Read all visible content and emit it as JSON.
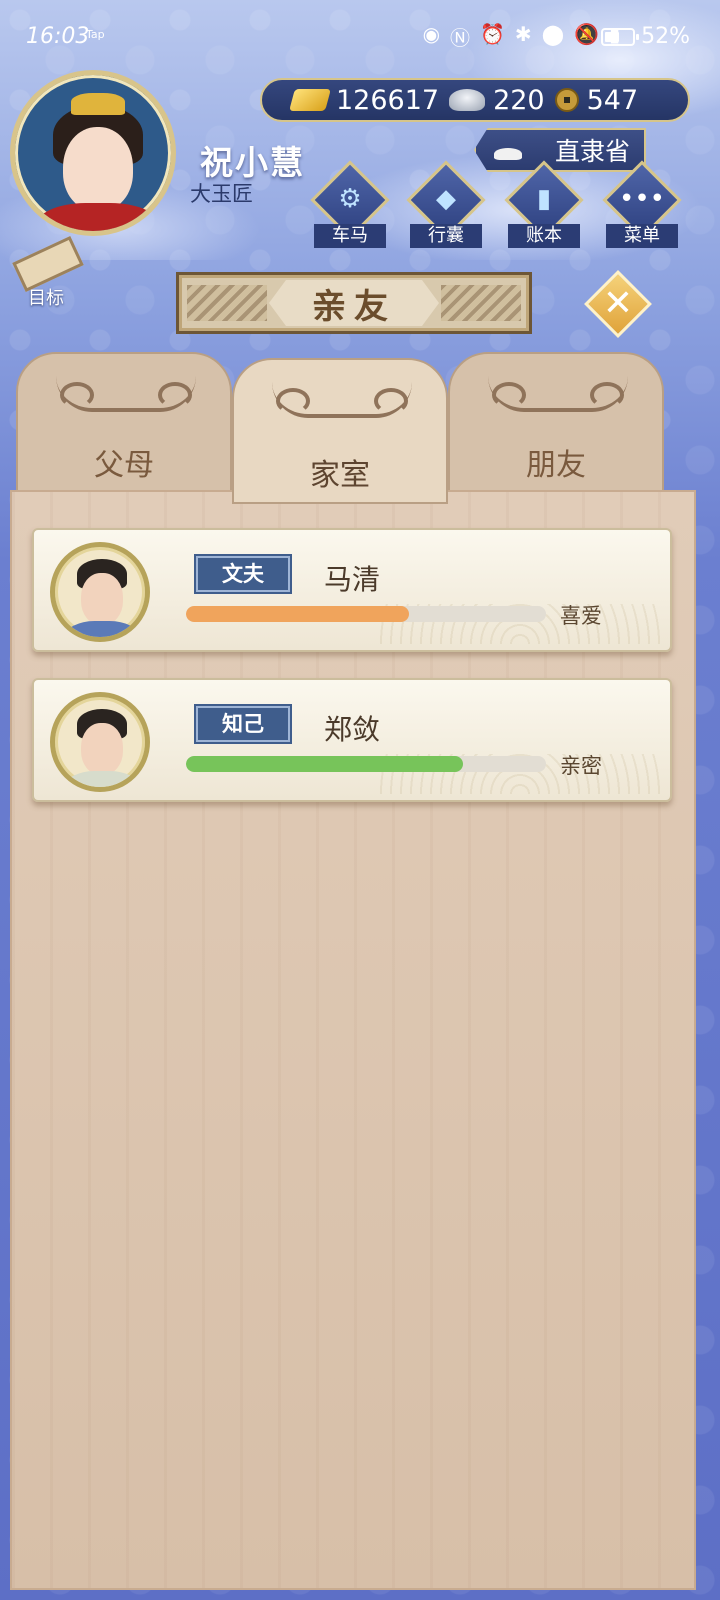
{
  "status_bar": {
    "time": "16:03",
    "tap_label": "Tap",
    "battery": "52%"
  },
  "player": {
    "name": "祝小慧",
    "title": "大玉匠"
  },
  "currency": {
    "gold": "126617",
    "silver": "220",
    "coins": "547"
  },
  "location": "直隶省",
  "menu": [
    {
      "label": "车马",
      "icon": "carriage-icon"
    },
    {
      "label": "行囊",
      "icon": "bundle-icon"
    },
    {
      "label": "账本",
      "icon": "ledger-icon"
    },
    {
      "label": "菜单",
      "icon": "more-icon"
    }
  ],
  "goal_label": "目标",
  "page_title": "亲友",
  "tabs": [
    {
      "label": "父母",
      "active": false
    },
    {
      "label": "家室",
      "active": true
    },
    {
      "label": "朋友",
      "active": false
    }
  ],
  "relations": [
    {
      "role": "文夫",
      "name": "马清",
      "affinity": 0.62,
      "status": "喜爱",
      "bar_color": "#f0a45c"
    },
    {
      "role": "知己",
      "name": "郑敛",
      "affinity": 0.77,
      "status": "亲密",
      "bar_color": "#77c45a"
    }
  ]
}
